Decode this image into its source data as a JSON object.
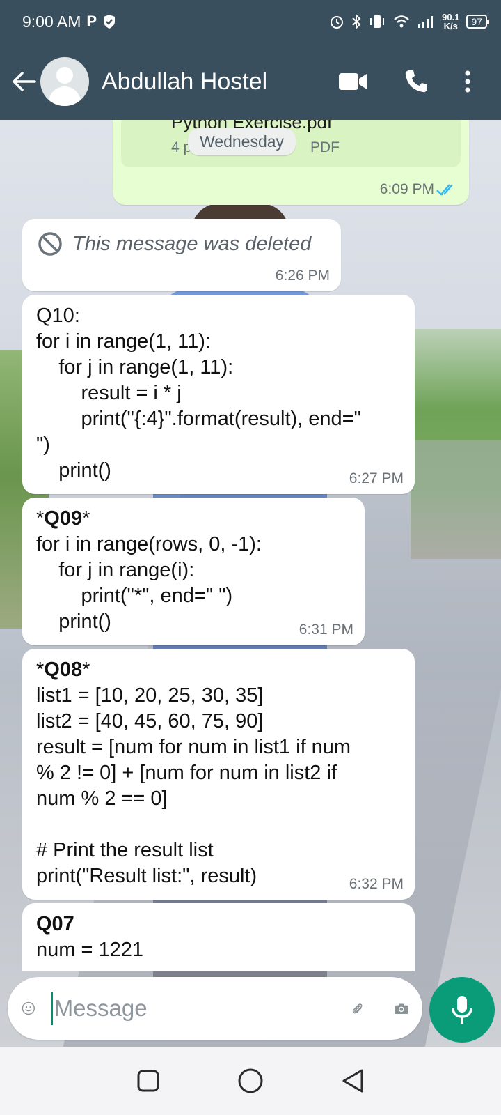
{
  "status_bar": {
    "time": "9:00 AM",
    "net_speed_value": "90.1",
    "net_speed_unit": "K/s",
    "battery": "97"
  },
  "header": {
    "contact_name": "Abdullah Hostel"
  },
  "pdf_message": {
    "file_name": "Python Exercise.pdf",
    "meta_prefix": "4 p",
    "file_type": "PDF",
    "time": "6:09 PM"
  },
  "date_chip": "Wednesday",
  "messages": [
    {
      "type": "deleted",
      "text": "This message was deleted",
      "time": "6:26 PM"
    },
    {
      "type": "text",
      "text": "Q10:\nfor i in range(1, 11):\n    for j in range(1, 11):\n        result = i * j\n        print(\"{:4}\".format(result), end=\"\n\")\n    print()",
      "time": "6:27 PM"
    },
    {
      "type": "text",
      "bold_title": "Q09",
      "text": "for i in range(rows, 0, -1):\n    for j in range(i):\n        print(\"*\", end=\" \")\n    print()",
      "time": "6:31 PM"
    },
    {
      "type": "text",
      "bold_title": "Q08",
      "text": "list1 = [10, 20, 25, 30, 35]\nlist2 = [40, 45, 60, 75, 90]\nresult = [num for num in list1 if num\n% 2 != 0] + [num for num in list2 if\nnum % 2 == 0]\n\n# Print the result list\nprint(\"Result list:\", result)",
      "time": "6:32 PM"
    },
    {
      "type": "text",
      "bold_title": "Q07",
      "text": "num = 1221",
      "time": ""
    }
  ],
  "composer": {
    "placeholder": "Message"
  },
  "colors": {
    "header_bg": "#3a4f5e",
    "outgoing_bubble": "#e7fed2",
    "mic_button": "#0a9c78",
    "read_ticks": "#34b7f1"
  }
}
